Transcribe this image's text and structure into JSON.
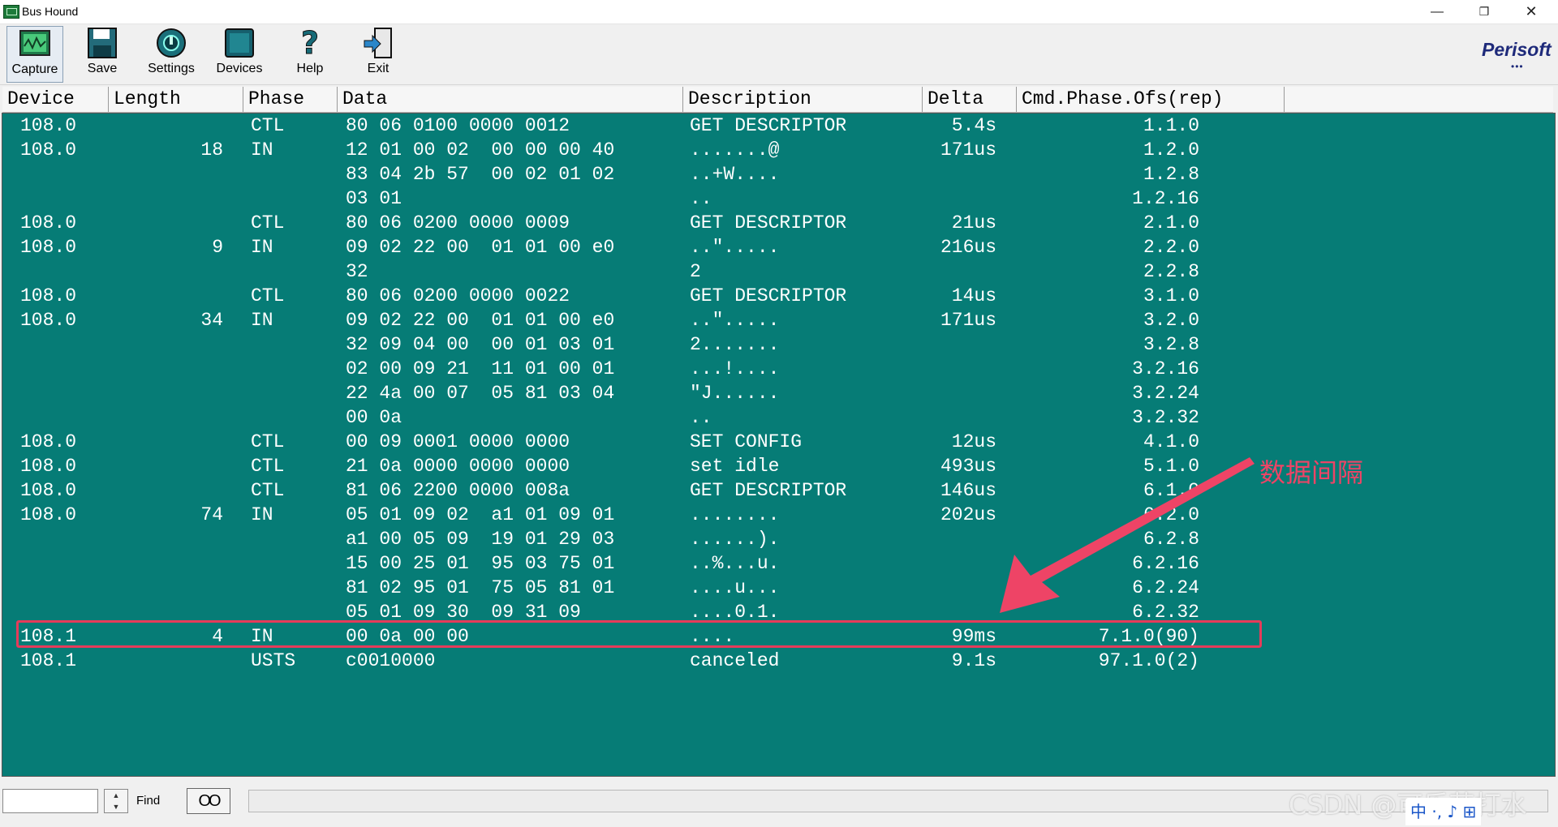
{
  "window": {
    "title": "Bus Hound",
    "controls": {
      "minimize": "—",
      "maximize": "❐",
      "close": "✕"
    }
  },
  "toolbar": {
    "buttons": [
      {
        "label": "Capture",
        "icon": "capture-icon"
      },
      {
        "label": "Save",
        "icon": "save-icon"
      },
      {
        "label": "Settings",
        "icon": "settings-icon"
      },
      {
        "label": "Devices",
        "icon": "devices-icon"
      },
      {
        "label": "Help",
        "icon": "help-icon"
      },
      {
        "label": "Exit",
        "icon": "exit-icon"
      }
    ],
    "brand": "Perisoft",
    "brand_dots": "•••"
  },
  "columns": [
    "Device",
    "Length",
    "Phase",
    "Data",
    "Description",
    "Delta",
    "Cmd.Phase.Ofs(rep)"
  ],
  "rows": [
    {
      "device": "108.0",
      "length": "",
      "phase": "CTL",
      "data": "80 06 0100 0000 0012",
      "desc": "GET DESCRIPTOR",
      "delta": "5.4s",
      "cmd": "1.1.0"
    },
    {
      "device": "108.0",
      "length": "18",
      "phase": "IN",
      "data": "12 01 00 02  00 00 00 40",
      "desc": ".......@",
      "delta": "171us",
      "cmd": "1.2.0"
    },
    {
      "device": "",
      "length": "",
      "phase": "",
      "data": "83 04 2b 57  00 02 01 02",
      "desc": "..+W....",
      "delta": "",
      "cmd": "1.2.8"
    },
    {
      "device": "",
      "length": "",
      "phase": "",
      "data": "03 01",
      "desc": "..",
      "delta": "",
      "cmd": "1.2.16"
    },
    {
      "device": "108.0",
      "length": "",
      "phase": "CTL",
      "data": "80 06 0200 0000 0009",
      "desc": "GET DESCRIPTOR",
      "delta": "21us",
      "cmd": "2.1.0"
    },
    {
      "device": "108.0",
      "length": "9",
      "phase": "IN",
      "data": "09 02 22 00  01 01 00 e0",
      "desc": "..\".....",
      "delta": "216us",
      "cmd": "2.2.0"
    },
    {
      "device": "",
      "length": "",
      "phase": "",
      "data": "32",
      "desc": "2",
      "delta": "",
      "cmd": "2.2.8"
    },
    {
      "device": "108.0",
      "length": "",
      "phase": "CTL",
      "data": "80 06 0200 0000 0022",
      "desc": "GET DESCRIPTOR",
      "delta": "14us",
      "cmd": "3.1.0"
    },
    {
      "device": "108.0",
      "length": "34",
      "phase": "IN",
      "data": "09 02 22 00  01 01 00 e0",
      "desc": "..\".....",
      "delta": "171us",
      "cmd": "3.2.0"
    },
    {
      "device": "",
      "length": "",
      "phase": "",
      "data": "32 09 04 00  00 01 03 01",
      "desc": "2.......",
      "delta": "",
      "cmd": "3.2.8"
    },
    {
      "device": "",
      "length": "",
      "phase": "",
      "data": "02 00 09 21  11 01 00 01",
      "desc": "...!....",
      "delta": "",
      "cmd": "3.2.16"
    },
    {
      "device": "",
      "length": "",
      "phase": "",
      "data": "22 4a 00 07  05 81 03 04",
      "desc": "\"J......",
      "delta": "",
      "cmd": "3.2.24"
    },
    {
      "device": "",
      "length": "",
      "phase": "",
      "data": "00 0a",
      "desc": "..",
      "delta": "",
      "cmd": "3.2.32"
    },
    {
      "device": "108.0",
      "length": "",
      "phase": "CTL",
      "data": "00 09 0001 0000 0000",
      "desc": "SET CONFIG",
      "delta": "12us",
      "cmd": "4.1.0"
    },
    {
      "device": "108.0",
      "length": "",
      "phase": "CTL",
      "data": "21 0a 0000 0000 0000",
      "desc": "set idle",
      "delta": "493us",
      "cmd": "5.1.0"
    },
    {
      "device": "108.0",
      "length": "",
      "phase": "CTL",
      "data": "81 06 2200 0000 008a",
      "desc": "GET DESCRIPTOR",
      "delta": "146us",
      "cmd": "6.1.0"
    },
    {
      "device": "108.0",
      "length": "74",
      "phase": "IN",
      "data": "05 01 09 02  a1 01 09 01",
      "desc": "........",
      "delta": "202us",
      "cmd": "6.2.0"
    },
    {
      "device": "",
      "length": "",
      "phase": "",
      "data": "a1 00 05 09  19 01 29 03",
      "desc": "......).",
      "delta": "",
      "cmd": "6.2.8"
    },
    {
      "device": "",
      "length": "",
      "phase": "",
      "data": "15 00 25 01  95 03 75 01",
      "desc": "..%...u.",
      "delta": "",
      "cmd": "6.2.16"
    },
    {
      "device": "",
      "length": "",
      "phase": "",
      "data": "81 02 95 01  75 05 81 01",
      "desc": "....u...",
      "delta": "",
      "cmd": "6.2.24"
    },
    {
      "device": "",
      "length": "",
      "phase": "",
      "data": "05 01 09 30  09 31 09",
      "desc": "....0.1.",
      "delta": "",
      "cmd": "6.2.32"
    },
    {
      "device": "108.1",
      "length": "4",
      "phase": "IN",
      "data": "00 0a 00 00",
      "desc": "....",
      "delta": "99ms",
      "cmd": "7.1.0(90)"
    },
    {
      "device": "108.1",
      "length": "",
      "phase": "USTS",
      "data": "c0010000",
      "desc": "canceled",
      "delta": "9.1s",
      "cmd": "97.1.0(2)"
    }
  ],
  "annotation": {
    "label": "数据间隔",
    "color": "#ee4466"
  },
  "statusbar": {
    "find_label": "Find",
    "find_value": "",
    "glasses": "OO",
    "watermark": "CSDN @可乐苏打水",
    "ime": "中 ·, ♪ ⊞"
  },
  "colors": {
    "data_bg": "#067c76",
    "text": "#ffffff",
    "highlight": "#e63b5a"
  }
}
